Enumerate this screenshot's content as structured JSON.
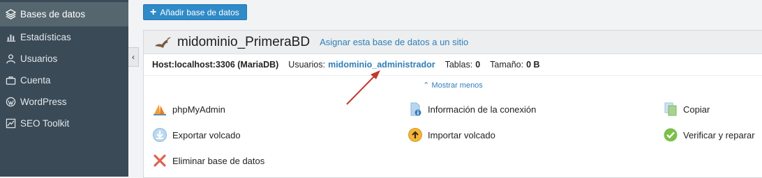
{
  "sidebar": {
    "items": [
      {
        "label": "Bases de datos",
        "icon": "layers-icon",
        "active": true
      },
      {
        "label": "Estadísticas",
        "icon": "bar-chart-icon"
      },
      {
        "label": "Usuarios",
        "icon": "user-icon"
      },
      {
        "label": "Cuenta",
        "icon": "briefcase-icon"
      },
      {
        "label": "WordPress",
        "icon": "wordpress-icon"
      },
      {
        "label": "SEO Toolkit",
        "icon": "seo-chart-icon"
      }
    ],
    "collapse_glyph": "‹"
  },
  "toolbar": {
    "add_db_label": "Añadir base de datos",
    "add_icon_glyph": "+"
  },
  "database": {
    "name": "midominio_PrimeraBD",
    "assign_link": "Asignar esta base de datos a un sitio",
    "host_label": "Host:localhost:3306 (MariaDB)",
    "users_label": "Usuarios:",
    "users_value": "midominio_administrador",
    "tables_label": "Tablas:",
    "tables_value": "0",
    "size_label": "Tamaño:",
    "size_value": "0 B",
    "show_less": "⌃ Mostrar menos"
  },
  "tools": {
    "phpmyadmin": "phpMyAdmin",
    "connection_info": "Información de la conexión",
    "copy": "Copiar",
    "export": "Exportar volcado",
    "import": "Importar volcado",
    "verify": "Verificar y reparar",
    "delete": "Eliminar base de datos"
  },
  "colors": {
    "sidebar_bg": "#3a4a57",
    "link": "#2f7fb8",
    "button": "#2f8ac8",
    "arrow": "#c0392b"
  }
}
